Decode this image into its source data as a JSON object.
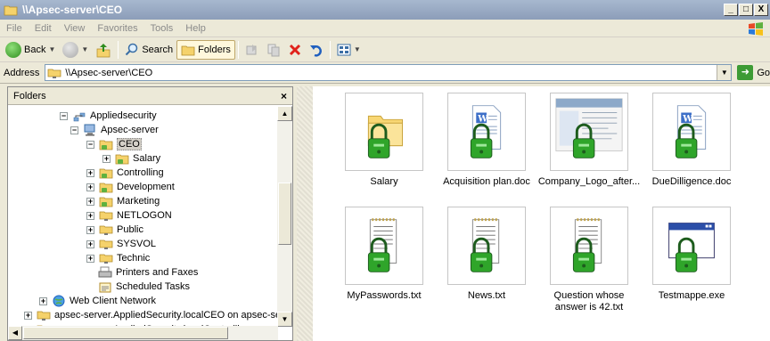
{
  "window": {
    "title": "\\\\Apsec-server\\CEO",
    "buttons": [
      "_",
      "□",
      "X"
    ]
  },
  "menu": [
    "File",
    "Edit",
    "View",
    "Favorites",
    "Tools",
    "Help"
  ],
  "toolbar": {
    "back_label": "Back",
    "search_label": "Search",
    "folders_label": "Folders"
  },
  "address": {
    "label": "Address",
    "value": "\\\\Apsec-server\\CEO",
    "go_label": "Go"
  },
  "folders_pane": {
    "title": "Folders",
    "close_glyph": "×",
    "tree": [
      {
        "label": "Appliedsecurity",
        "expander": "−",
        "icon": "network-group-icon"
      },
      {
        "label": "Apsec-server",
        "expander": "−",
        "icon": "computer-icon"
      },
      {
        "label": "CEO",
        "expander": "−",
        "icon": "shared-folder-icon",
        "selected": true
      },
      {
        "label": "Salary",
        "expander": "+",
        "icon": "shared-folder-icon"
      },
      {
        "label": "Controlling",
        "expander": "+",
        "icon": "shared-folder-icon"
      },
      {
        "label": "Development",
        "expander": "+",
        "icon": "shared-folder-icon"
      },
      {
        "label": "Marketing",
        "expander": "+",
        "icon": "shared-folder-icon"
      },
      {
        "label": "NETLOGON",
        "expander": "+",
        "icon": "network-drive-icon"
      },
      {
        "label": "Public",
        "expander": "+",
        "icon": "network-drive-icon"
      },
      {
        "label": "SYSVOL",
        "expander": "+",
        "icon": "network-drive-icon"
      },
      {
        "label": "Technic",
        "expander": "+",
        "icon": "network-drive-icon"
      },
      {
        "label": "Printers and Faxes",
        "expander": "",
        "icon": "printer-icon"
      },
      {
        "label": "Scheduled Tasks",
        "expander": "",
        "icon": "scheduled-tasks-icon"
      },
      {
        "label": "Web Client Network",
        "expander": "+",
        "icon": "globe-icon"
      },
      {
        "label": "apsec-server.AppliedSecurity.localCEO on apsec-server.App",
        "expander": "+",
        "icon": "network-drive-icon"
      },
      {
        "label": "apsec-server.AppliedSecurity.localControlling on apsec-serve",
        "expander": "+",
        "icon": "network-drive-icon"
      }
    ]
  },
  "files": [
    {
      "name": "Salary",
      "type": "folder",
      "icon": "locked-folder-icon"
    },
    {
      "name": "Acquisition plan.doc",
      "type": "doc",
      "icon": "locked-word-doc-icon"
    },
    {
      "name": "Company_Logo_after...",
      "type": "image",
      "icon": "locked-image-thumbnail"
    },
    {
      "name": "DueDilligence.doc",
      "type": "doc",
      "icon": "locked-word-doc-icon"
    },
    {
      "name": "MyPasswords.txt",
      "type": "txt",
      "icon": "locked-text-file-icon"
    },
    {
      "name": "News.txt",
      "type": "txt",
      "icon": "locked-text-file-icon"
    },
    {
      "name": "Question whose answer is 42.txt",
      "type": "txt",
      "icon": "locked-text-file-icon"
    },
    {
      "name": "Testmappe.exe",
      "type": "exe",
      "icon": "locked-exe-icon"
    }
  ]
}
